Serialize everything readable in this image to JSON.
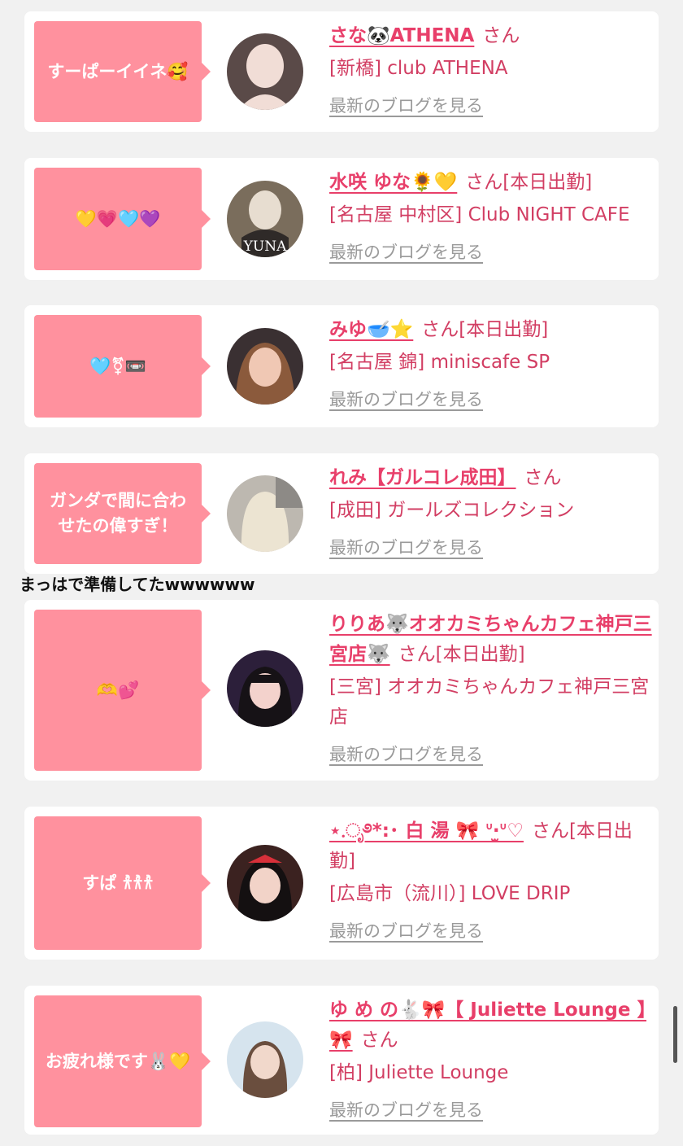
{
  "entries": [
    {
      "message": "すーぱーイイネ🥰",
      "name": "さな🐼ATHENA",
      "honorific": "さん",
      "shop": "[新橋] club ATHENA",
      "blog_link": "最新のブログを見る",
      "avatar_colors": [
        "#5a4a48",
        "#f1ddd6"
      ]
    },
    {
      "message": "💛💗🩵💜",
      "name": "水咲 ゆな🌻💛",
      "honorific": "さん[本日出勤]",
      "shop": "[名古屋 中村区] Club NIGHT CAFE",
      "blog_link": "最新のブログを見る",
      "avatar_colors": [
        "#7a6d5c",
        "#e7ddd0"
      ],
      "avatar_text": "YUNA"
    },
    {
      "message": "🩵⚧📼",
      "name": "みゆ🥣⭐",
      "honorific": "さん[本日出勤]",
      "shop": "[名古屋 錦] miniscafe SP",
      "blog_link": "最新のブログを見る",
      "avatar_colors": [
        "#3a3032",
        "#f0c8b4"
      ]
    },
    {
      "message": "ガンダで間に合わせたの偉すぎ！",
      "name": "れみ【ガルコレ成田】",
      "honorific": "さん",
      "shop": "[成田] ガールズコレクション",
      "blog_link": "最新のブログを見る",
      "avatar_colors": [
        "#bdb8b0",
        "#ece4d2"
      ]
    },
    {
      "message": "🫶💕",
      "name": "りりあ🐺オオカミちゃんカフェ神戸三宮店🐺",
      "honorific": "さん[本日出勤]",
      "shop": "[三宮] オオカミちゃんカフェ神戸三宮店",
      "blog_link": "最新のブログを見る",
      "avatar_colors": [
        "#2c1f3a",
        "#f3d2cc"
      ]
    },
    {
      "message": "すぱ 𐀪𐀪𐀪",
      "name": "⋆.ೃ࿔*:･ 白 湯 🎀 ᐡ‧̫ᐡ♡",
      "honorific": "さん[本日出勤]",
      "shop": "[広島市（流川）] LOVE DRIP",
      "blog_link": "最新のブログを見る",
      "avatar_colors": [
        "#3b2220",
        "#f2d3c8"
      ]
    },
    {
      "message": "お疲れ様です🐰💛",
      "name": "ゆ め の🐇🎀【 Juliette Lounge 】🎀",
      "honorific": "さん",
      "shop": "[柏] Juliette Lounge",
      "blog_link": "最新のブログを見る",
      "avatar_colors": [
        "#d6e4ee",
        "#f1d8cb"
      ]
    }
  ],
  "comment_overlay": "まっはで準備してたwwwwww",
  "colors": {
    "bubble": "#ff919e",
    "name": "#e83f6a",
    "shop": "#d23e63",
    "blog_link": "#9a9a9a",
    "background": "#f1f1f1"
  }
}
